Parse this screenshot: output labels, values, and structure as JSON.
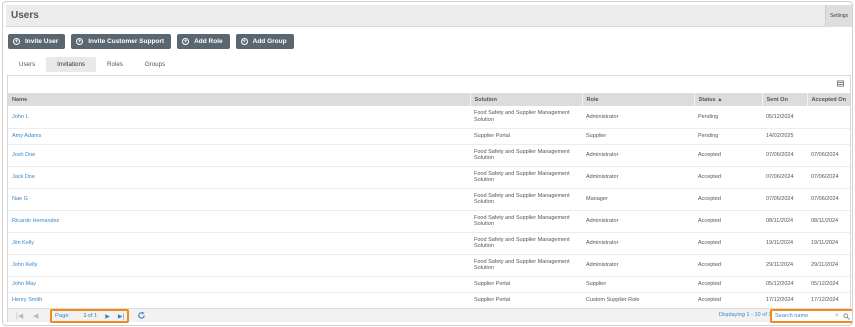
{
  "header": {
    "title": "Users",
    "settings_label": "Settings"
  },
  "actions": [
    {
      "label": "Invite User"
    },
    {
      "label": "Invite Customer Support"
    },
    {
      "label": "Add Role"
    },
    {
      "label": "Add Group"
    }
  ],
  "tabs": [
    {
      "label": "Users",
      "active": false
    },
    {
      "label": "Invitations",
      "active": true
    },
    {
      "label": "Roles",
      "active": false
    },
    {
      "label": "Groups",
      "active": false
    }
  ],
  "table": {
    "columns": [
      "Name",
      "Solution",
      "Role",
      "Status ▲",
      "Sent On",
      "Accepted On"
    ],
    "rows": [
      {
        "name": "John L",
        "solution": "Food Safety and Supplier Management Solution",
        "role": "Administrator",
        "status": "Pending",
        "sent": "05/12/2024",
        "accepted": ""
      },
      {
        "name": "Amy Adams",
        "solution": "Supplier Portal",
        "role": "Supplier",
        "status": "Pending",
        "sent": "14/02/2025",
        "accepted": ""
      },
      {
        "name": "Josh Doe",
        "solution": "Food Safety and Supplier Management Solution",
        "role": "Administrator",
        "status": "Accepted",
        "sent": "07/06/2024",
        "accepted": "07/06/2024"
      },
      {
        "name": "Jack Doe",
        "solution": "Food Safety and Supplier Management Solution",
        "role": "Administrator",
        "status": "Accepted",
        "sent": "07/06/2024",
        "accepted": "07/06/2024"
      },
      {
        "name": "Nae G",
        "solution": "Food Safety and Supplier Management Solution",
        "role": "Manager",
        "status": "Accepted",
        "sent": "07/06/2024",
        "accepted": "07/06/2024"
      },
      {
        "name": "Ricardo Hernandez",
        "solution": "Food Safety and Supplier Management Solution",
        "role": "Administrator",
        "status": "Accepted",
        "sent": "08/11/2024",
        "accepted": "08/11/2024"
      },
      {
        "name": "Jim Kelly",
        "solution": "Food Safety and Supplier Management Solution",
        "role": "Administrator",
        "status": "Accepted",
        "sent": "19/11/2024",
        "accepted": "19/11/2024"
      },
      {
        "name": "John Kelly",
        "solution": "Food Safety and Supplier Management Solution",
        "role": "Administrator",
        "status": "Accepted",
        "sent": "29/11/2024",
        "accepted": "29/11/2024"
      },
      {
        "name": "John May",
        "solution": "Supplier Portal",
        "role": "Supplier",
        "status": "Accepted",
        "sent": "05/12/2024",
        "accepted": "05/12/2024"
      },
      {
        "name": "Henry Smith",
        "solution": "Supplier Portal",
        "role": "Custom Supplier Role",
        "status": "Accepted",
        "sent": "17/12/2024",
        "accepted": "17/12/2024"
      }
    ]
  },
  "pager": {
    "page_label": "Page",
    "page_value": "1",
    "of_label": "of 1",
    "display_text": "Displaying 1 - 10 of 10",
    "search_placeholder": "Search name",
    "icons": {
      "first": "first-page-icon",
      "prev": "prev-page-icon",
      "next": "next-page-icon",
      "last": "last-page-icon",
      "refresh": "refresh-icon",
      "clear": "clear-icon",
      "search": "search-icon"
    }
  },
  "colors": {
    "link": "#3a86c9",
    "button": "#5b6770",
    "highlight": "#f08a1c",
    "header_bg": "#ececec"
  }
}
